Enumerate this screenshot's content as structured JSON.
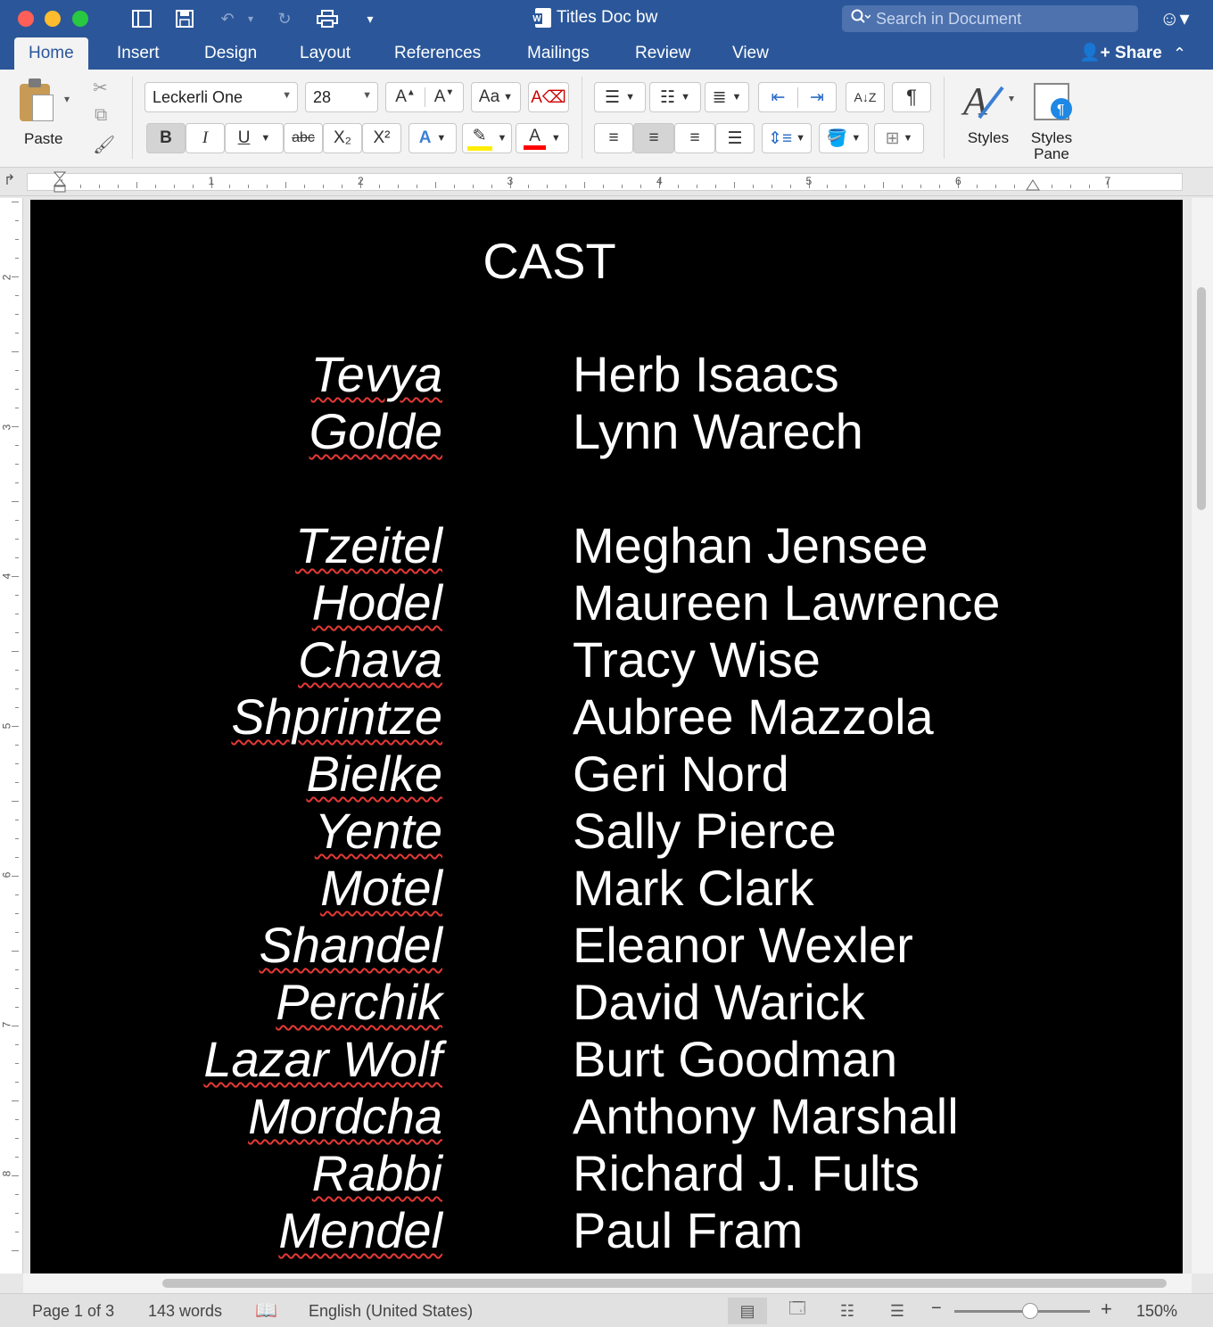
{
  "window": {
    "title": "Titles Doc bw",
    "search_placeholder": "Search in Document",
    "qat": {
      "undo_dropdown": "▾",
      "customize": "▾"
    }
  },
  "tabs": [
    "Home",
    "Insert",
    "Design",
    "Layout",
    "References",
    "Mailings",
    "Review",
    "View"
  ],
  "active_tab": "Home",
  "share_label": "Share",
  "ribbon": {
    "paste_label": "Paste",
    "font_name": "Leckerli One",
    "font_size": "28",
    "bold": "B",
    "italic": "I",
    "underline": "U",
    "strikethrough": "abc",
    "subscript": "X₂",
    "superscript": "X²",
    "styles_label": "Styles",
    "styles_pane_label_line1": "Styles",
    "styles_pane_label_line2": "Pane"
  },
  "ruler": {
    "numbers": [
      "1",
      "2",
      "3",
      "4",
      "5",
      "6",
      "7"
    ],
    "vnumbers": [
      "2",
      "3",
      "4",
      "5",
      "6",
      "7",
      "8"
    ]
  },
  "document": {
    "heading": "CAST",
    "cast": [
      {
        "role": "Tevya",
        "actor": "Herb Isaacs"
      },
      {
        "role": "Golde",
        "actor": "Lynn Warech"
      },
      {
        "role": "Tzeitel",
        "actor": "Meghan Jensee"
      },
      {
        "role": "Hodel",
        "actor": "Maureen Lawrence"
      },
      {
        "role": "Chava",
        "actor": "Tracy Wise"
      },
      {
        "role": "Shprintze",
        "actor": "Aubree Mazzola"
      },
      {
        "role": "Bielke",
        "actor": "Geri Nord"
      },
      {
        "role": "Yente",
        "actor": "Sally Pierce"
      },
      {
        "role": "Motel",
        "actor": "Mark Clark"
      },
      {
        "role": "Shandel",
        "actor": "Eleanor Wexler"
      },
      {
        "role": "Perchik",
        "actor": "David Warick"
      },
      {
        "role": "Lazar Wolf",
        "actor": "Burt Goodman"
      },
      {
        "role": "Mordcha",
        "actor": "Anthony Marshall"
      },
      {
        "role": "Rabbi",
        "actor": "Richard J. Fults"
      },
      {
        "role": "Mendel",
        "actor": "Paul Fram"
      }
    ]
  },
  "status": {
    "page": "Page 1 of 3",
    "words": "143 words",
    "language": "English (United States)",
    "zoom": "150%",
    "zoom_level_fraction": 0.5
  },
  "colors": {
    "ribbon_blue": "#2b579a",
    "page_background": "#000000",
    "page_text": "#ffffff",
    "spellcheck": "#e53935",
    "highlight": "#ffff00",
    "font_color": "#ff0000"
  }
}
